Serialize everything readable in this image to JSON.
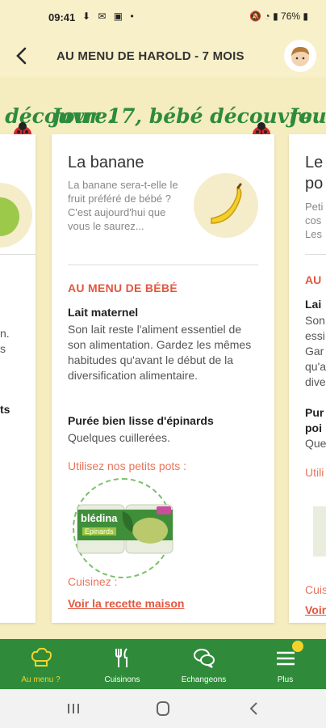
{
  "status": {
    "time": "09:41",
    "battery": "76%"
  },
  "header": {
    "title": "AU MENU DE HAROLD - 7 MOIS"
  },
  "day_label": "Jour 17, bébé découvre.",
  "left_card": {
    "frag1": "n.",
    "frag2": "s",
    "frag3": "ts"
  },
  "main_card": {
    "name": "La banane",
    "intro": "La banane sera-t-elle le fruit préféré de bébé ? C'est aujourd'hui que vous le saurez...",
    "section": "AU MENU DE BÉBÉ",
    "item1_title": "Lait maternel",
    "item1_desc": "Son lait reste l'aliment essentiel de son alimentation. Gardez les mêmes habitudes qu'avant le début de la diversification alimentaire.",
    "item2_title": "Purée bien lisse d'épinards",
    "item2_desc": "Quelques cuillerées.",
    "products_label": "Utilisez nos petits pots :",
    "product_brand": "blédina",
    "product_name": "Epinards",
    "cook_label": "Cuisinez :",
    "recipe_link": "Voir la recette maison"
  },
  "right_card": {
    "name1": "Le",
    "name2": "po",
    "intro1": "Peti",
    "intro2": "cos",
    "intro3": "Les",
    "sect": "AU",
    "t1": "Lai",
    "d1": "Son",
    "d2": "essi",
    "d3": "Gar",
    "d4": "qu'a",
    "d5": "dive",
    "t2": "Pur",
    "t3": "poi",
    "d6": "Que",
    "util": "Utili",
    "cuis": "Cuis",
    "voir": "Voir"
  },
  "nav": {
    "items": [
      {
        "label": "Au menu ?",
        "icon": "chef-hat-icon"
      },
      {
        "label": "Cuisinons",
        "icon": "cutlery-icon"
      },
      {
        "label": "Echangeons",
        "icon": "chat-bubbles-icon"
      },
      {
        "label": "Plus",
        "icon": "menu-icon"
      }
    ]
  },
  "colors": {
    "green": "#2f8b3a",
    "accent": "#e2573f",
    "highlight": "#f2d32b",
    "background": "#f7f0c9"
  }
}
